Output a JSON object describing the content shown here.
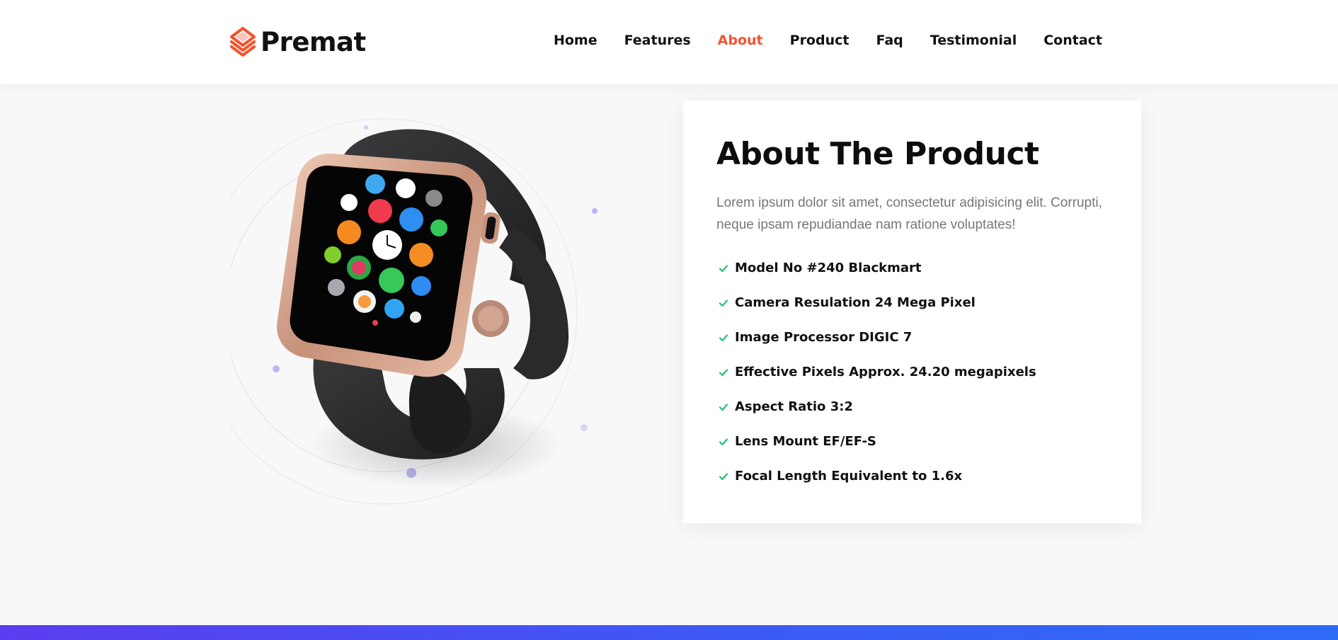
{
  "brand": {
    "name": "Premat",
    "logo_icon": "layered-chevron-logo",
    "accent_color": "#f2542d"
  },
  "nav": {
    "items": [
      {
        "label": "Home",
        "active": false
      },
      {
        "label": "Features",
        "active": false
      },
      {
        "label": "About",
        "active": true
      },
      {
        "label": "Product",
        "active": false
      },
      {
        "label": "Faq",
        "active": false
      },
      {
        "label": "Testimonial",
        "active": false
      },
      {
        "label": "Contact",
        "active": false
      }
    ]
  },
  "about": {
    "title": "About The Product",
    "description": "Lorem ipsum dolor sit amet, consectetur adipisicing elit. Corrupti, neque ipsam repudiandae nam ratione voluptates!",
    "check_icon": "check-icon",
    "check_color": "#1fc46f",
    "features": [
      "Model No #240 Blackmart",
      "Camera Resulation 24 Mega Pixel",
      "Image Processor DIGIC 7",
      "Effective Pixels Approx. 24.20 megapixels",
      "Aspect Ratio 3:2",
      "Lens Mount EF/EF-S",
      "Focal Length Equivalent to 1.6x"
    ]
  },
  "product_image": {
    "icon": "smartwatch-image"
  },
  "bottom_band_colors": [
    "#5a3df0",
    "#2d6bf5"
  ]
}
